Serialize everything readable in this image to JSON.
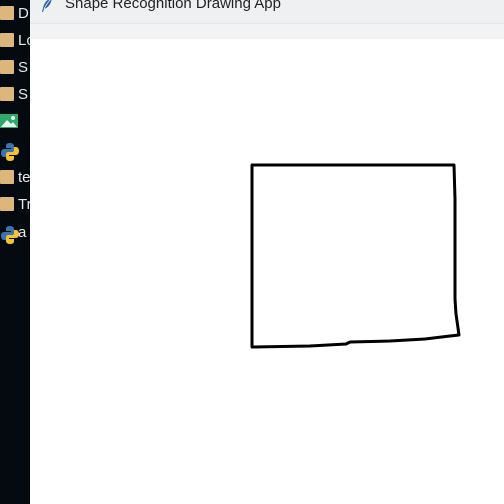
{
  "explorer": {
    "items": [
      {
        "icon": "folder-icon",
        "label": "D"
      },
      {
        "icon": "folder-icon",
        "label": "Lo"
      },
      {
        "icon": "folder-icon",
        "label": "S"
      },
      {
        "icon": "folder-icon",
        "label": "S"
      },
      {
        "icon": "image-icon",
        "label": ""
      },
      {
        "icon": "python-icon",
        "label": ""
      },
      {
        "icon": "folder-icon",
        "label": "te"
      },
      {
        "icon": "folder-icon",
        "label": "Tr"
      },
      {
        "icon": "python-icon",
        "label": "a"
      }
    ]
  },
  "window": {
    "title": "Shape Recognition Drawing App",
    "icon": "feather-icon"
  },
  "canvas": {
    "background": "#ffffff",
    "stroke_color": "#000000",
    "drawn_shape": "rectangle"
  }
}
